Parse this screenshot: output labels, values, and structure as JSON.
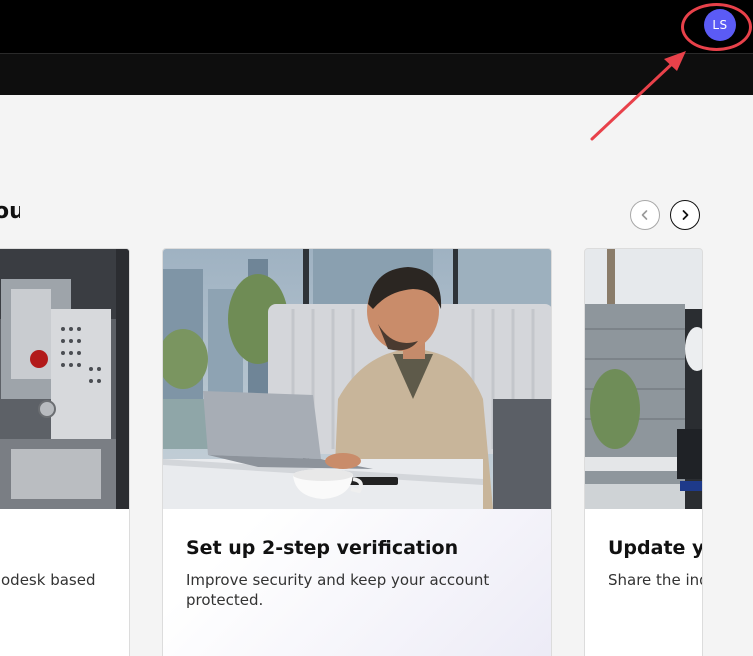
{
  "header": {
    "avatar_initials": "LS",
    "avatar_color": "#5b5bf5",
    "highlight_color": "#e8414a"
  },
  "section": {
    "title_fragment": "ou"
  },
  "carousel": {
    "prev_icon": "chevron-left-icon",
    "next_icon": "chevron-right-icon"
  },
  "cards": [
    {
      "title": "",
      "description": "odesk based",
      "image": "industrial-machine-photo"
    },
    {
      "title": "Set up 2-step verification",
      "description": "Improve security and keep your account protected.",
      "image": "man-with-laptop-photo"
    },
    {
      "title": "Update yo",
      "description": "Share the ind experiences",
      "image": "robot-camera-photo"
    }
  ]
}
